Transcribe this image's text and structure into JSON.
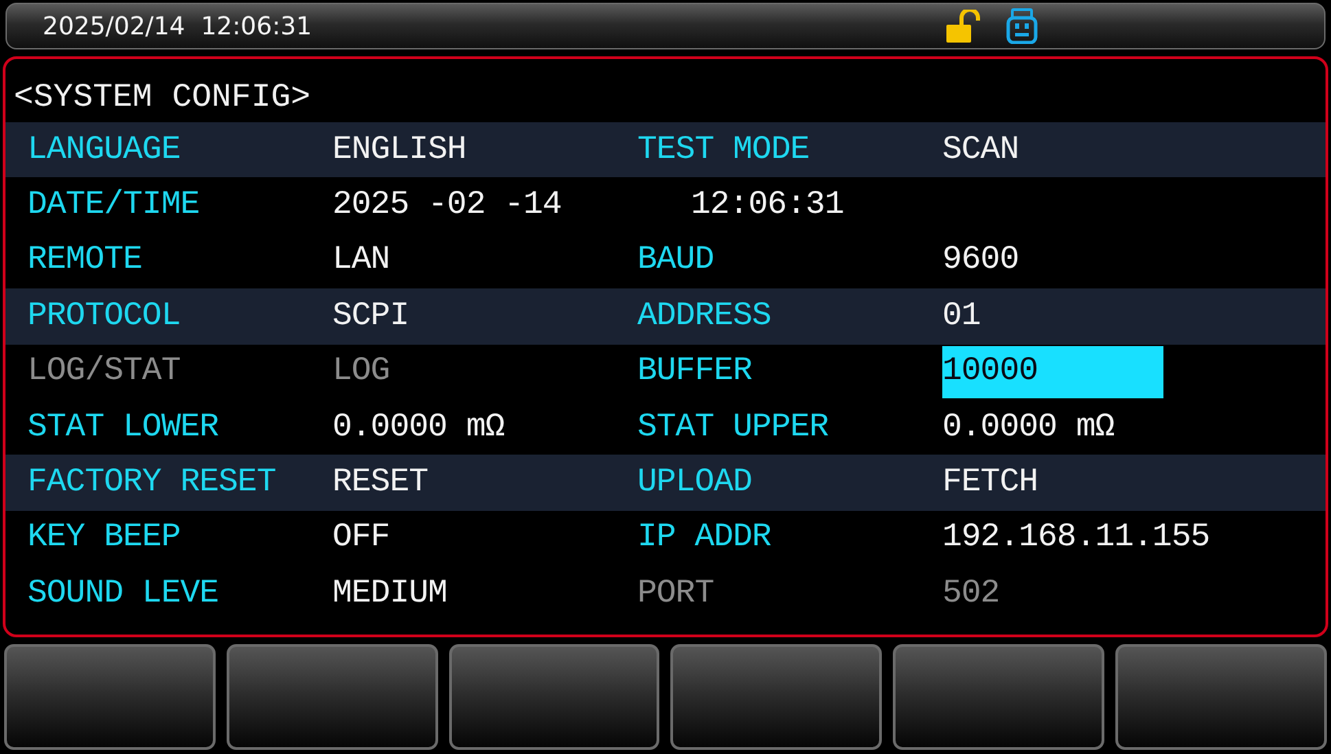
{
  "status_bar": {
    "datetime": "2025/02/14  12:06:31",
    "locked": false
  },
  "panel": {
    "title": "<SYSTEM CONFIG>",
    "rows": [
      {
        "kind": "pair",
        "left": {
          "label": "LANGUAGE",
          "value": "ENGLISH",
          "disabled": false,
          "selected": false
        },
        "right": {
          "label": "TEST MODE",
          "value": "SCAN",
          "disabled": false,
          "selected": false
        }
      },
      {
        "kind": "datetime",
        "label": "DATE/TIME",
        "date": "2025 -02 -14",
        "time": "12:06:31"
      },
      {
        "kind": "pair",
        "left": {
          "label": "REMOTE",
          "value": "LAN",
          "disabled": false,
          "selected": false
        },
        "right": {
          "label": "BAUD",
          "value": "9600",
          "disabled": false,
          "selected": false
        }
      },
      {
        "kind": "pair",
        "left": {
          "label": "PROTOCOL",
          "value": "SCPI",
          "disabled": false,
          "selected": false
        },
        "right": {
          "label": "ADDRESS",
          "value": "01",
          "disabled": false,
          "selected": false
        }
      },
      {
        "kind": "pair",
        "left": {
          "label": "LOG/STAT",
          "value": "LOG",
          "disabled": true,
          "selected": false
        },
        "right": {
          "label": "BUFFER",
          "value": "10000",
          "disabled": false,
          "selected": true
        }
      },
      {
        "kind": "pair",
        "left": {
          "label": "STAT LOWER",
          "value": "0.0000 mΩ",
          "disabled": false,
          "selected": false
        },
        "right": {
          "label": "STAT UPPER",
          "value": "0.0000 mΩ",
          "disabled": false,
          "selected": false
        }
      },
      {
        "kind": "pair",
        "left": {
          "label": "FACTORY RESET",
          "value": "RESET",
          "disabled": false,
          "selected": false
        },
        "right": {
          "label": "UPLOAD",
          "value": "FETCH",
          "disabled": false,
          "selected": false
        }
      },
      {
        "kind": "pair",
        "left": {
          "label": "KEY BEEP",
          "value": "OFF",
          "disabled": false,
          "selected": false
        },
        "right": {
          "label": "IP ADDR",
          "value": "192.168.11.155",
          "disabled": false,
          "selected": false
        }
      },
      {
        "kind": "pair",
        "left": {
          "label": "SOUND LEVE",
          "value": "MEDIUM",
          "disabled": false,
          "selected": false
        },
        "right": {
          "label": "PORT",
          "value": "502",
          "disabled": true,
          "selected": false
        }
      }
    ]
  }
}
